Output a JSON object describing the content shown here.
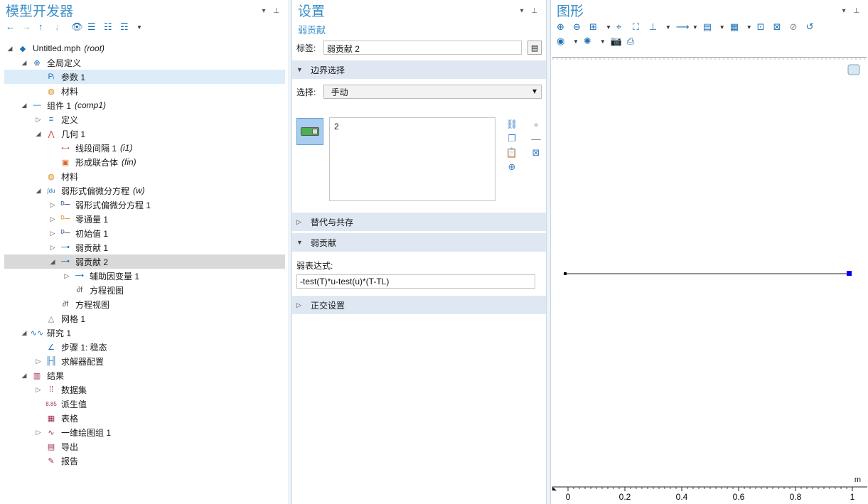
{
  "model_builder": {
    "title": "模型开发器",
    "tree": [
      {
        "label": "Untitled.mph",
        "sub": "(root)",
        "icon": "model-icon",
        "level": 0,
        "toggle": "◢"
      },
      {
        "label": "全局定义",
        "icon": "globe-icon",
        "level": 1,
        "toggle": "◢"
      },
      {
        "label": "参数 1",
        "icon": "parameters-icon",
        "level": 2,
        "toggle": ""
      },
      {
        "label": "材料",
        "icon": "materials-icon",
        "level": 2,
        "toggle": ""
      },
      {
        "label": "组件 1",
        "sub": "(comp1)",
        "icon": "component-icon",
        "level": 1,
        "toggle": "◢"
      },
      {
        "label": "定义",
        "icon": "definitions-icon",
        "level": 2,
        "toggle": "▷"
      },
      {
        "label": "几何 1",
        "icon": "geometry-icon",
        "level": 2,
        "toggle": "◢"
      },
      {
        "label": "线段间隔 1",
        "sub": "(i1)",
        "icon": "interval-icon",
        "level": 3,
        "toggle": ""
      },
      {
        "label": "形成联合体",
        "sub": "(fin)",
        "icon": "union-icon",
        "level": 3,
        "toggle": ""
      },
      {
        "label": "材料",
        "icon": "materials-icon",
        "level": 2,
        "toggle": ""
      },
      {
        "label": "弱形式偏微分方程",
        "sub": "(w)",
        "icon": "weak-form-icon",
        "level": 2,
        "toggle": "◢"
      },
      {
        "label": "弱形式偏微分方程 1",
        "icon": "pde-node-icon",
        "level": 3,
        "toggle": "▷"
      },
      {
        "label": "零通量 1",
        "icon": "zero-flux-icon",
        "level": 3,
        "toggle": "▷"
      },
      {
        "label": "初始值 1",
        "icon": "initial-values-icon",
        "level": 3,
        "toggle": "▷"
      },
      {
        "label": "弱贡献 1",
        "icon": "weak-contribution-icon",
        "level": 3,
        "toggle": "▷"
      },
      {
        "label": "弱贡献 2",
        "icon": "weak-contribution-icon",
        "level": 3,
        "toggle": "◢"
      },
      {
        "label": "辅助因变量 1",
        "icon": "aux-variable-icon",
        "level": 4,
        "toggle": "▷"
      },
      {
        "label": "方程视图",
        "icon": "equation-view-icon",
        "level": 4,
        "toggle": ""
      },
      {
        "label": "方程视图",
        "icon": "equation-view-icon",
        "level": 3,
        "toggle": ""
      },
      {
        "label": "网格 1",
        "icon": "mesh-icon",
        "level": 2,
        "toggle": ""
      },
      {
        "label": "研究 1",
        "icon": "study-icon",
        "level": 1,
        "toggle": "◢"
      },
      {
        "label": "步骤 1: 稳态",
        "icon": "stationary-icon",
        "level": 2,
        "toggle": ""
      },
      {
        "label": "求解器配置",
        "icon": "solver-icon",
        "level": 2,
        "toggle": "▷"
      },
      {
        "label": "结果",
        "icon": "results-icon",
        "level": 1,
        "toggle": "◢"
      },
      {
        "label": "数据集",
        "icon": "datasets-icon",
        "level": 2,
        "toggle": "▷"
      },
      {
        "label": "派生值",
        "icon": "derived-values-icon",
        "level": 2,
        "toggle": ""
      },
      {
        "label": "表格",
        "icon": "table-icon",
        "level": 2,
        "toggle": ""
      },
      {
        "label": "一维绘图组 1",
        "icon": "plot-group-icon",
        "level": 2,
        "toggle": "▷"
      },
      {
        "label": "导出",
        "icon": "export-icon",
        "level": 2,
        "toggle": ""
      },
      {
        "label": "报告",
        "icon": "report-icon",
        "level": 2,
        "toggle": ""
      }
    ]
  },
  "settings": {
    "title": "设置",
    "subtitle": "弱贡献",
    "label_caption": "标签:",
    "label_value": "弱贡献 2",
    "section_boundary": "边界选择",
    "selection_caption": "选择:",
    "selection_value": "手动",
    "selected_entities": "2",
    "section_override": "替代与共存",
    "section_weak": "弱贡献",
    "weak_expr_caption": "弱表达式:",
    "weak_expr_value": "-test(T)*u-test(u)*(T-TL)",
    "section_orthogonal": "正交设置"
  },
  "graphics": {
    "title": "图形",
    "unit": "m",
    "axis_ticks": [
      "0",
      "0.2",
      "0.4",
      "0.6",
      "0.8",
      "1"
    ]
  },
  "colors": {
    "accent": "#3a8ec8",
    "selection": "#dcecf9",
    "selected_boundary": "#0000ff"
  }
}
